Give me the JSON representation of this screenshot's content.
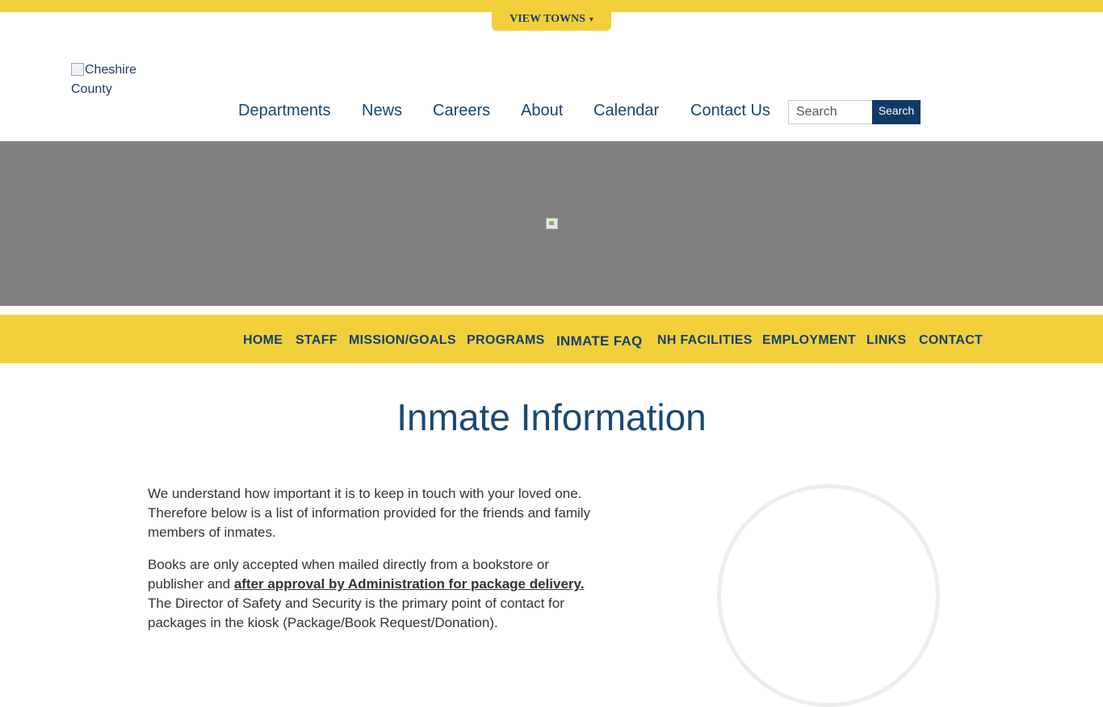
{
  "top_bar": {
    "view_towns_label": "VIEW TOWNS",
    "view_towns_icon": "caret-down"
  },
  "header": {
    "logo_alt": "Cheshire County",
    "nav": [
      {
        "label": "Departments"
      },
      {
        "label": "News"
      },
      {
        "label": "Careers"
      },
      {
        "label": "About"
      },
      {
        "label": "Calendar"
      },
      {
        "label": "Contact Us"
      }
    ],
    "search": {
      "placeholder": "Search",
      "button_label": "Search"
    }
  },
  "sub_nav": {
    "items": [
      {
        "label": "HOME"
      },
      {
        "label": "STAFF"
      },
      {
        "label": "MISSION/GOALS"
      },
      {
        "label": "PROGRAMS"
      },
      {
        "label": "INMATE FAQ",
        "active": true
      },
      {
        "label": "NH FACILITIES"
      },
      {
        "label": "EMPLOYMENT"
      },
      {
        "label": "LINKS"
      },
      {
        "label": "CONTACT"
      }
    ]
  },
  "main": {
    "title": "Inmate Information",
    "intro": "We understand how important it is to keep in touch with your loved one.  Therefore below is a list of information provided for the friends and family members of inmates.",
    "books_lead": "Books are only accepted when mailed directly from a bookstore or publisher and ",
    "books_link": "after approval by Administration for package delivery. ",
    "books_tail": " The Director of Safety and Security is the primary point of contact for packages in the kiosk (Package/Book Request/Donation)."
  },
  "colors": {
    "accent_yellow": "#f2d03b",
    "navy": "#0f3a66",
    "hero_gray": "#808080"
  }
}
